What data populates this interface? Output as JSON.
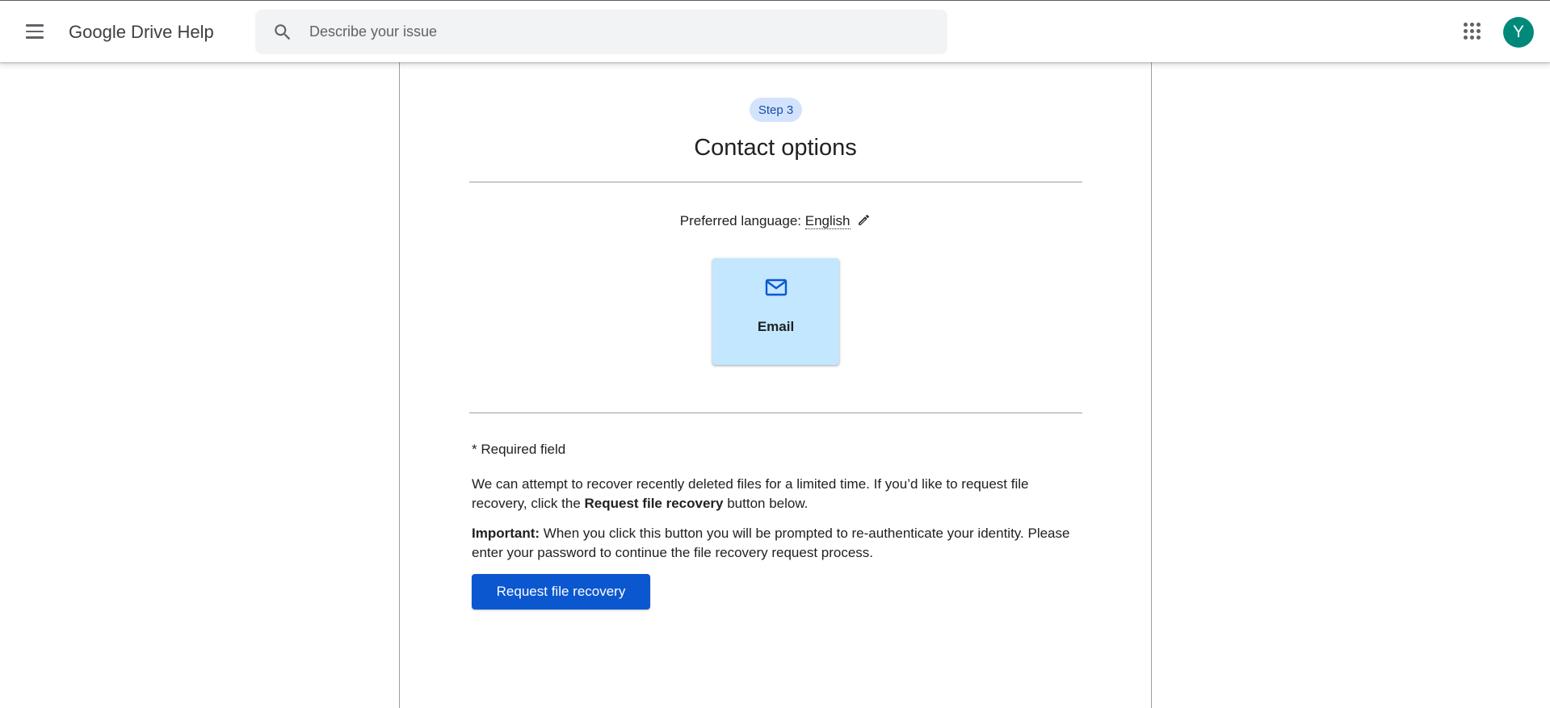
{
  "header": {
    "menu_icon": "hamburger-menu-icon",
    "product_name": "Google Drive Help",
    "search": {
      "placeholder": "Describe your issue",
      "value": ""
    },
    "apps_icon": "apps-grid-icon",
    "avatar_letter": "Y",
    "avatar_color": "#00897b"
  },
  "card": {
    "step_label": "Step 3",
    "title": "Contact options",
    "preferred_language_label": "Preferred language:",
    "preferred_language_value": "English",
    "edit_icon": "pencil-icon",
    "contact_options": [
      {
        "icon": "mail-icon",
        "label": "Email"
      }
    ],
    "required_note": "* Required field",
    "paragraph1": {
      "text_before": "We can attempt to recover recently deleted files for a limited time. If you’d like to request file recovery, click the ",
      "bold": "Request file recovery",
      "text_after": " button below."
    },
    "paragraph2": {
      "bold": "Important:",
      "text": " When you click this button you will be prompted to re-authenticate your identity. Please enter your password to continue the file recovery request process."
    },
    "primary_button": "Request file recovery"
  },
  "colors": {
    "primary": "#0b57d0",
    "tile_bg": "#c2e7ff",
    "badge_bg": "#d3e3fd",
    "badge_text": "#174ea6"
  }
}
